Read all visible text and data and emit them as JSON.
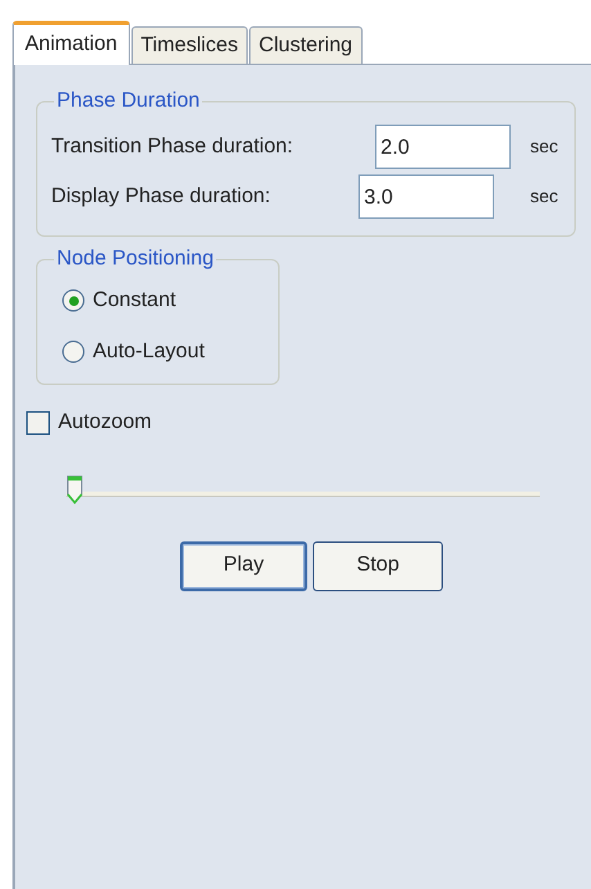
{
  "tabs": [
    {
      "label": "Animation",
      "selected": true
    },
    {
      "label": "Timeslices",
      "selected": false
    },
    {
      "label": "Clustering",
      "selected": false
    }
  ],
  "phase_duration": {
    "title": "Phase Duration",
    "fields": [
      {
        "label": "Transition Phase duration:",
        "value": "2.0",
        "unit": "sec"
      },
      {
        "label": "Display Phase duration:",
        "value": "3.0",
        "unit": "sec"
      }
    ]
  },
  "node_positioning": {
    "title": "Node Positioning",
    "options": [
      {
        "label": "Constant",
        "selected": true
      },
      {
        "label": "Auto-Layout",
        "selected": false
      }
    ]
  },
  "autozoom": {
    "label": "Autozoom",
    "checked": false
  },
  "slider": {
    "level": 0
  },
  "buttons": [
    {
      "label": "Play",
      "focused": true
    },
    {
      "label": "Stop",
      "focused": false
    }
  ]
}
